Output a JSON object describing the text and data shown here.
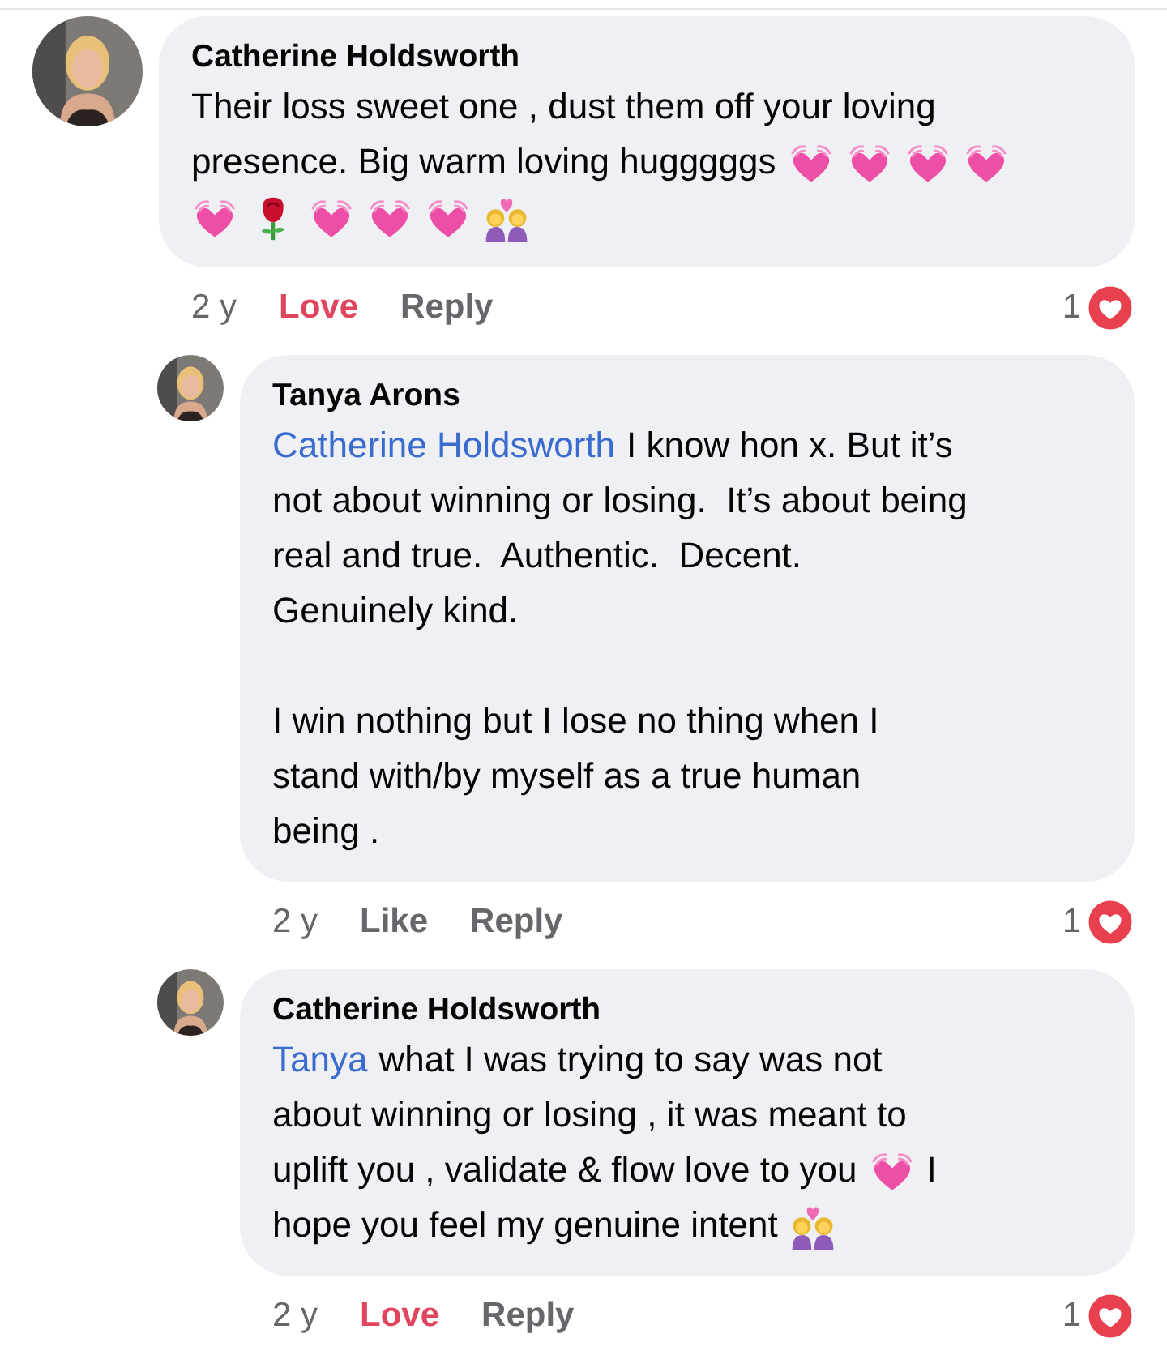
{
  "comments": [
    {
      "author": "Catherine Holdsworth",
      "reply": false,
      "paragraphs": [
        [
          [
            {
              "kind": "text",
              "text": "Their loss sweet one , dust them off your loving"
            }
          ],
          [
            {
              "kind": "text",
              "text": "presence. Big warm loving hugggggs"
            },
            {
              "kind": "heart"
            },
            {
              "kind": "heart"
            },
            {
              "kind": "heart"
            },
            {
              "kind": "heart"
            }
          ],
          [
            {
              "kind": "heart"
            },
            {
              "kind": "rose"
            },
            {
              "kind": "heart"
            },
            {
              "kind": "heart"
            },
            {
              "kind": "heart"
            },
            {
              "kind": "couple"
            }
          ]
        ]
      ],
      "time": "2 y",
      "reaction": {
        "label": "Love",
        "reacted": true
      },
      "reply_label": "Reply",
      "count": "1"
    },
    {
      "author": "Tanya Arons",
      "reply": true,
      "paragraphs": [
        [
          [
            {
              "kind": "mention",
              "text": "Catherine Holdsworth"
            },
            {
              "kind": "text",
              "text": "I know hon x. But it’s"
            }
          ],
          [
            {
              "kind": "text",
              "text": "not about winning or losing.  It’s about being"
            }
          ],
          [
            {
              "kind": "text",
              "text": "real and true.  Authentic.  Decent."
            }
          ],
          [
            {
              "kind": "text",
              "text": "Genuinely kind."
            }
          ]
        ],
        [
          [
            {
              "kind": "text",
              "text": "I win nothing but I lose no thing when I"
            }
          ],
          [
            {
              "kind": "text",
              "text": "stand with/by myself as a true human"
            }
          ],
          [
            {
              "kind": "text",
              "text": "being ."
            }
          ]
        ]
      ],
      "time": "2 y",
      "reaction": {
        "label": "Like",
        "reacted": false
      },
      "reply_label": "Reply",
      "count": "1"
    },
    {
      "author": "Catherine Holdsworth",
      "reply": true,
      "paragraphs": [
        [
          [
            {
              "kind": "mention",
              "text": "Tanya"
            },
            {
              "kind": "text",
              "text": "what I was trying to say was not"
            }
          ],
          [
            {
              "kind": "text",
              "text": "about winning or losing , it was meant to"
            }
          ],
          [
            {
              "kind": "text",
              "text": "uplift you , validate & flow love to you"
            },
            {
              "kind": "heart"
            },
            {
              "kind": "text",
              "text": "I"
            }
          ],
          [
            {
              "kind": "text",
              "text": "hope you feel my genuine intent"
            },
            {
              "kind": "couple"
            }
          ]
        ]
      ],
      "time": "2 y",
      "reaction": {
        "label": "Love",
        "reacted": true
      },
      "reply_label": "Reply",
      "count": "1"
    }
  ]
}
